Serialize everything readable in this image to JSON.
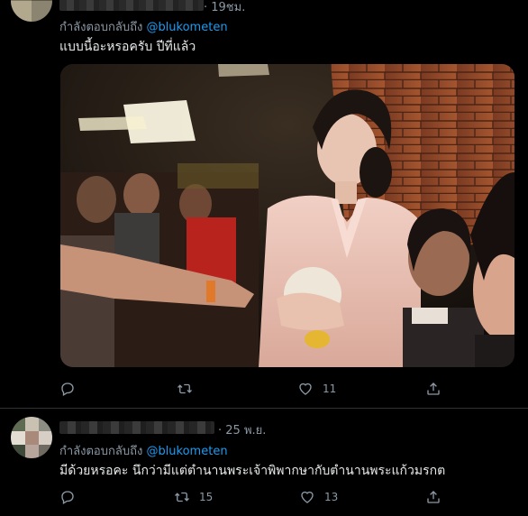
{
  "tweets": [
    {
      "time": "· 19ชม.",
      "reply_prefix": "กำลังตอบกลับถึง",
      "reply_handle": "@blukometen",
      "text": "แบบนี้อะหรอครับ ปีที่แล้ว",
      "actions": {
        "replies": "",
        "retweets": "",
        "likes": "11"
      }
    },
    {
      "time": "· 25 พ.ย.",
      "reply_prefix": "กำลังตอบกลับถึง",
      "reply_handle": "@blukometen",
      "text": "มีด้วยหรอคะ นึกว่ามีแต่ตำนานพระเจ้าพิพากษากับตำนานพระแก้วมรกต",
      "actions": {
        "replies": "",
        "retweets": "15",
        "likes": "13"
      }
    }
  ],
  "icons": [
    "reply-icon",
    "retweet-icon",
    "like-icon",
    "share-icon"
  ],
  "colors": {
    "background": "#000000",
    "link": "#1d9bf0",
    "muted": "#8b98a5",
    "text": "#e7e9ea",
    "divider": "#2f3336"
  }
}
